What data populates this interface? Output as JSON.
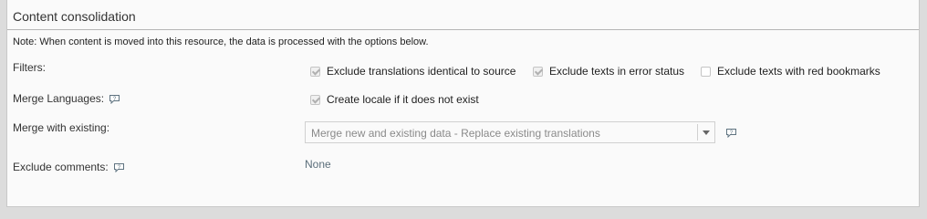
{
  "section": {
    "title": "Content consolidation",
    "note": "Note: When content is moved into this resource, the data is processed with the options below."
  },
  "filters": {
    "label": "Filters:",
    "options": [
      {
        "label": "Exclude translations identical to source",
        "checked": true
      },
      {
        "label": "Exclude texts in error status",
        "checked": true
      },
      {
        "label": "Exclude texts with red bookmarks",
        "checked": false
      }
    ]
  },
  "merge_languages": {
    "label": "Merge Languages:",
    "option": {
      "label": "Create locale if it does not exist",
      "checked": true
    },
    "icon": "help-icon"
  },
  "merge_existing": {
    "label": "Merge with existing:",
    "selected": "Merge new and existing data - Replace existing translations",
    "icon": "help-icon"
  },
  "exclude_comments": {
    "label": "Exclude comments:",
    "value": "None",
    "icon": "help-icon"
  }
}
